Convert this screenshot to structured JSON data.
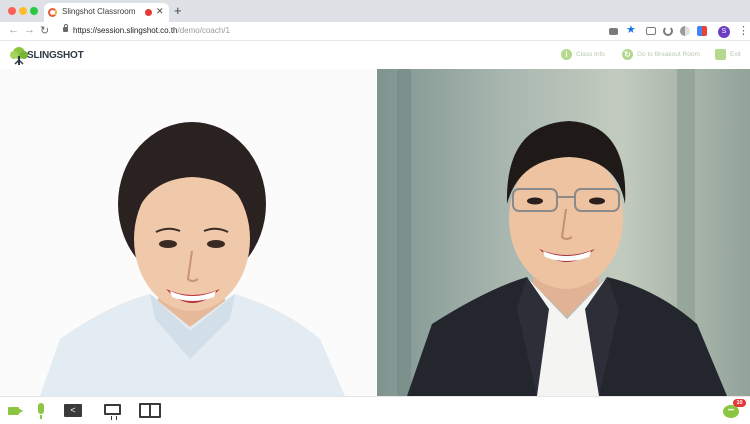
{
  "browser": {
    "tab_title": "Slingshot Classroom",
    "tab_close": "✕",
    "new_tab": "+",
    "url_host": "https://session.slingshot.co.th",
    "url_path": "/demo/coach/1",
    "profile_initial": "S",
    "nav": {
      "back": "←",
      "forward": "→",
      "reload": "↻"
    },
    "menu": "⋮",
    "star": "★"
  },
  "app": {
    "logo_text": "SLINGSHOT",
    "header_actions": [
      {
        "label": "Class Info",
        "icon": "info-icon",
        "glyph": "i"
      },
      {
        "label": "Go to Breakout Room",
        "icon": "switch-icon",
        "glyph": "↻"
      },
      {
        "label": "Exit",
        "icon": "exit-icon",
        "glyph": ""
      }
    ]
  },
  "participants": [
    {
      "role": "student-video",
      "description": "woman"
    },
    {
      "role": "coach-video",
      "description": "man"
    }
  ],
  "bottom_bar": {
    "share_glyph": "<",
    "chat_glyph": "•••",
    "chat_badge": "10"
  },
  "colors": {
    "accent_green": "#8cc541",
    "record_red": "#e53935",
    "profile_purple": "#6a3fc2"
  }
}
